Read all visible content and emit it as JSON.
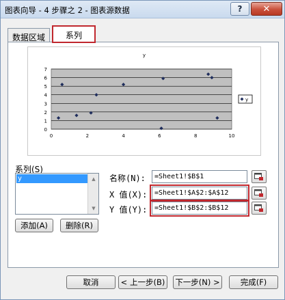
{
  "window": {
    "title": "图表向导 - 4 步骤之 2 - 图表源数据",
    "help_label": "?",
    "close_label": "✕"
  },
  "tabs": [
    {
      "label": "数据区域",
      "active": false
    },
    {
      "label": "系列",
      "active": true
    }
  ],
  "chart_data": {
    "type": "scatter",
    "title": "y",
    "legend": "y",
    "legend_position": "right",
    "grid": true,
    "xlim": [
      0,
      10
    ],
    "ylim": [
      0,
      7
    ],
    "x_ticks": [
      "0",
      "2",
      "4",
      "6",
      "8",
      "10"
    ],
    "y_ticks": [
      "0",
      "1",
      "2",
      "3",
      "4",
      "5",
      "6",
      "7"
    ],
    "series": [
      {
        "name": "y",
        "x": [
          0.4,
          0.6,
          1.4,
          2.2,
          2.5,
          4.0,
          6.1,
          6.2,
          8.7,
          8.9,
          9.2
        ],
        "y": [
          1.3,
          5.2,
          1.6,
          1.9,
          4.0,
          5.2,
          0.1,
          5.9,
          6.4,
          6.0,
          1.3
        ]
      }
    ]
  },
  "series_panel": {
    "label": "系列(S)",
    "items": [
      "y"
    ],
    "add_label": "添加(A)",
    "delete_label": "删除(R)"
  },
  "fields": {
    "name_label": "名称(N):",
    "name_value": "=Sheet1!$B$1",
    "x_label": "X 值(X):",
    "x_value": "=Sheet1!$A$2:$A$12",
    "y_label": "Y 值(Y):",
    "y_value": "=Sheet1!$B$2:$B$12"
  },
  "footer": {
    "cancel": "取消",
    "back": "< 上一步(B)",
    "next": "下一步(N) >",
    "finish": "完成(F)"
  },
  "colors": {
    "highlight": "#c0272d",
    "marker": "#1f2d5c",
    "plot_area": "#c0c0c0",
    "selection": "#3399ff"
  }
}
